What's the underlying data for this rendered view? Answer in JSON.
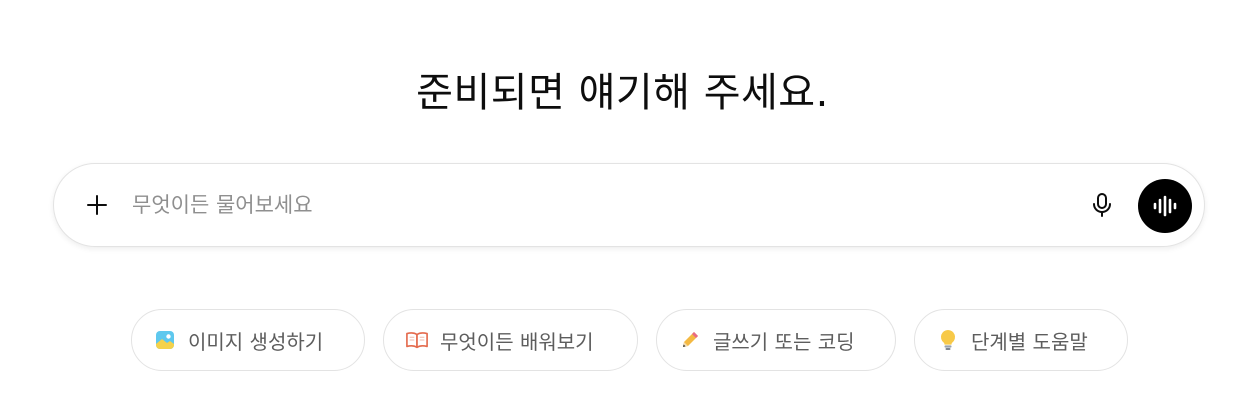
{
  "heading": "준비되면 얘기해 주세요.",
  "composer": {
    "placeholder": "무엇이든 물어보세요",
    "value": "",
    "add_icon": "plus-icon",
    "mic_icon": "microphone-icon",
    "voice_icon": "voice-waveform-icon"
  },
  "suggestions": [
    {
      "label": "이미지 생성하기",
      "icon": "image-icon"
    },
    {
      "label": "무엇이든 배워보기",
      "icon": "open-book-icon"
    },
    {
      "label": "글쓰기 또는 코딩",
      "icon": "pencil-icon"
    },
    {
      "label": "단계별 도움말",
      "icon": "lightbulb-icon"
    }
  ],
  "colors": {
    "voice_button": "#000000",
    "border": "#e3e3e3",
    "placeholder": "#8f8f8f",
    "chip_text": "#5d5d5d"
  }
}
